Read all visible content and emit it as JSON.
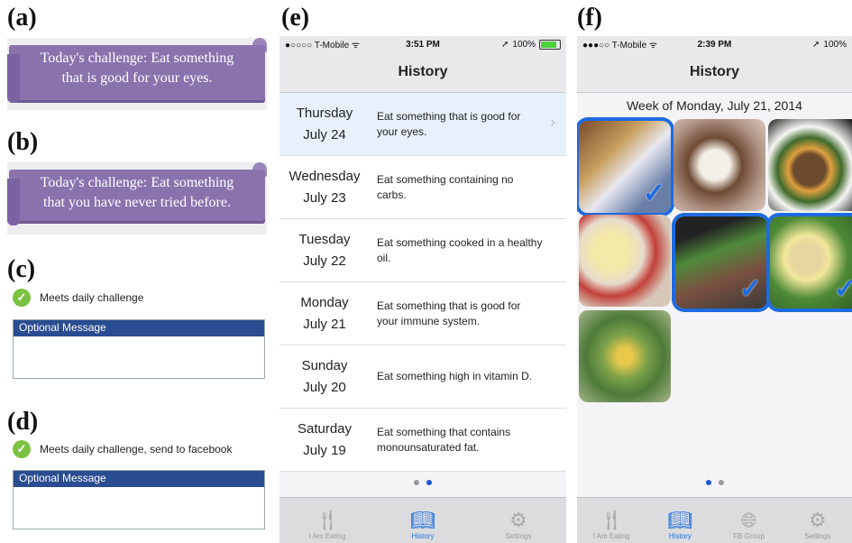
{
  "labels": {
    "a": "(a)",
    "b": "(b)",
    "c": "(c)",
    "d": "(d)",
    "e": "(e)",
    "f": "(f)"
  },
  "banner_a": {
    "line1": "Today's challenge: Eat something",
    "line2": "that is good for your eyes."
  },
  "banner_b": {
    "line1": "Today's challenge: Eat something",
    "line2": "that you have never tried before."
  },
  "panel_c": {
    "check_text": "Meets daily challenge",
    "box_header": "Optional Message"
  },
  "panel_d": {
    "check_text": "Meets daily challenge, send to facebook",
    "box_header": "Optional Message"
  },
  "phone_e": {
    "carrier": "●○○○○ T-Mobile ᯤ",
    "time": "3:51 PM",
    "battery": "100%",
    "title": "History",
    "rows": [
      {
        "day": "Thursday",
        "date": "July 24",
        "desc": "Eat something that is good for your eyes."
      },
      {
        "day": "Wednesday",
        "date": "July 23",
        "desc": "Eat something containing no carbs."
      },
      {
        "day": "Tuesday",
        "date": "July 22",
        "desc": "Eat something cooked in a healthy oil."
      },
      {
        "day": "Monday",
        "date": "July 21",
        "desc": "Eat something that is good for your immune system."
      },
      {
        "day": "Sunday",
        "date": "July 20",
        "desc": "Eat something high in vitamin D."
      },
      {
        "day": "Saturday",
        "date": "July 19",
        "desc": "Eat something that contains monounsaturated fat."
      }
    ],
    "tabs": [
      "I Am Eating",
      "History",
      "Settings"
    ]
  },
  "phone_f": {
    "carrier": "●●●○○ T-Mobile ᯤ",
    "time": "2:39 PM",
    "battery": "100%",
    "title": "History",
    "week": "Week of Monday, July 21, 2014",
    "tabs": [
      "I Am Eating",
      "History",
      "FB Group",
      "Settings"
    ]
  },
  "colors": {
    "banner": "#8a72ad",
    "accent": "#1e6be0",
    "check": "#7cc242",
    "msg_header": "#2a4c90"
  }
}
